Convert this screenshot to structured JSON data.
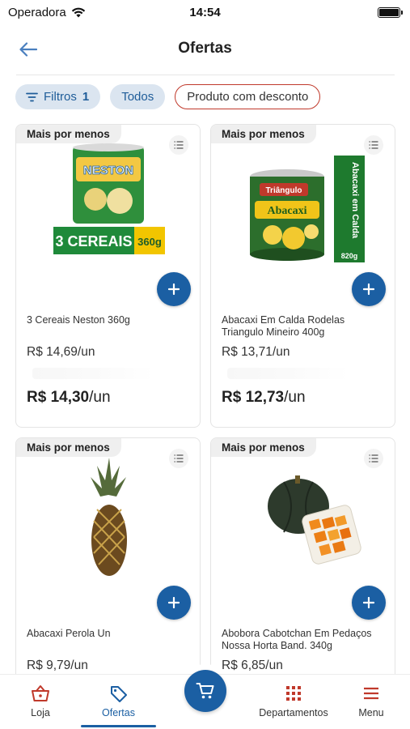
{
  "status_bar": {
    "carrier": "Operadora",
    "time": "14:54"
  },
  "header": {
    "title": "Ofertas"
  },
  "filters": {
    "filters_label": "Filtros",
    "filters_count": "1",
    "all_label": "Todos",
    "discount_label": "Produto com desconto"
  },
  "products": [
    {
      "badge": "Mais por menos",
      "name": "3 Cereais Neston 360g",
      "old_price": "R$ 14,69/un",
      "final_price": "R$ 14,30",
      "unit": "/un",
      "image": "cereal-can",
      "image_text_main": "3 CEREAIS",
      "image_text_size": "360g",
      "image_brand": "NESTON"
    },
    {
      "badge": "Mais por menos",
      "name": "Abacaxi Em Calda Rodelas Triangulo Mineiro 400g",
      "old_price": "R$ 13,71/un",
      "final_price": "R$ 12,73",
      "unit": "/un",
      "image": "pineapple-can",
      "image_text_main": "Abacaxi em Calda",
      "image_text_size": "820g",
      "image_brand": "Triângulo",
      "image_label": "Abacaxi"
    },
    {
      "badge": "Mais por menos",
      "name": "Abacaxi Perola Un",
      "old_price": "R$ 9,79/un",
      "image": "pineapple"
    },
    {
      "badge": "Mais por menos",
      "name": "Abobora Cabotchan Em Pedaços Nossa Horta Band. 340g",
      "old_price": "R$ 6,85/un",
      "image": "pumpkin"
    }
  ],
  "bottom_nav": {
    "items": [
      {
        "label": "Loja",
        "icon": "basket-icon"
      },
      {
        "label": "Ofertas",
        "icon": "tag-icon"
      },
      {
        "label": "Departamentos",
        "icon": "grid-icon"
      },
      {
        "label": "Menu",
        "icon": "hamburger-icon"
      }
    ],
    "active": "Ofertas",
    "cart_icon": "cart-icon"
  },
  "colors": {
    "primary": "#1b5fa3",
    "accent_red": "#c0392b",
    "chip_bg": "#dbe5f0"
  }
}
